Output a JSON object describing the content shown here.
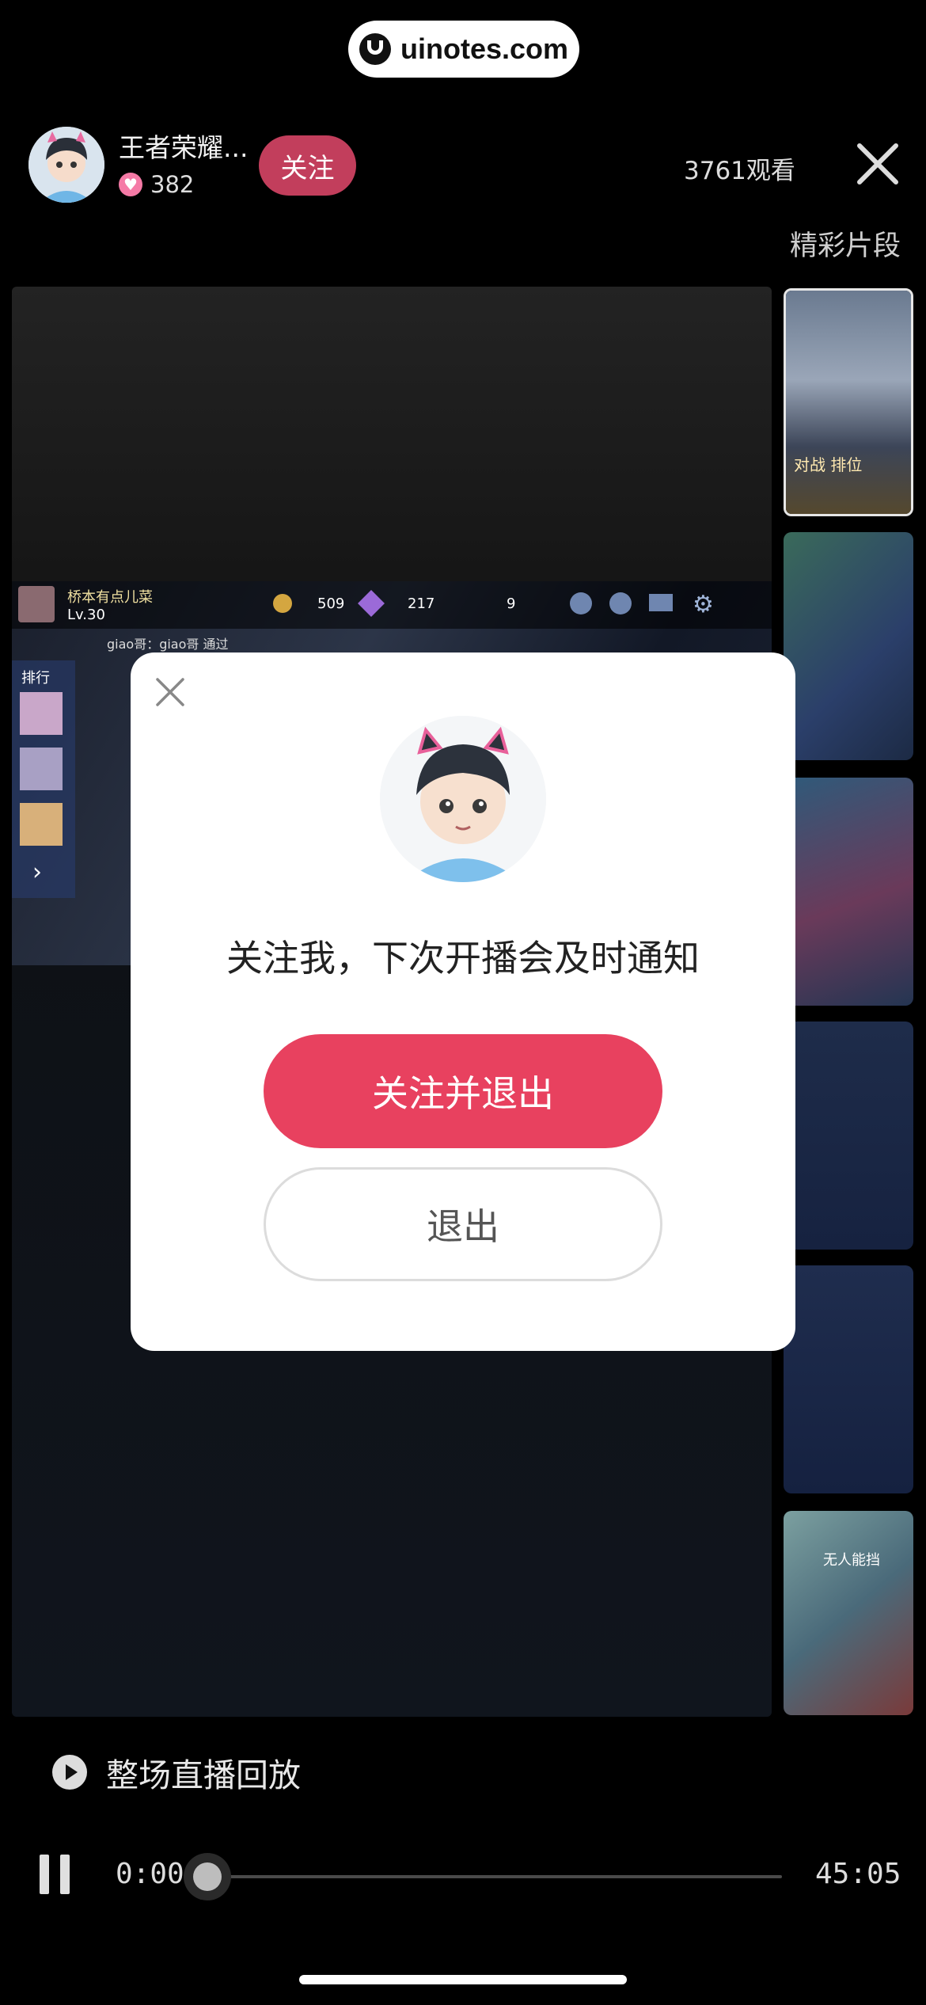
{
  "watermark": {
    "text": "uinotes.com"
  },
  "header": {
    "streamer_name": "王者荣耀...",
    "likes": "382",
    "follow_label": "关注",
    "views": "3761观看",
    "highlights_label": "精彩片段"
  },
  "game_overlay": {
    "player_name": "桥本有点儿菜",
    "level": "Lv.30",
    "coins": "509",
    "gems": "217",
    "tickets": "9",
    "chat": "giao哥：giao哥 通过",
    "rank_label": "排行"
  },
  "thumbnails": [
    {
      "label": "对战  排位",
      "selected": true,
      "color": "#5c6b82"
    },
    {
      "label": "",
      "selected": false,
      "color": "#3a5a4a"
    },
    {
      "label": "",
      "selected": false,
      "color": "#2f4b6a"
    },
    {
      "label": "",
      "selected": false,
      "color": "#1e2c4a"
    },
    {
      "label": "",
      "selected": false,
      "color": "#1f2d4e"
    },
    {
      "label": "无人能挡",
      "selected": false,
      "color": "#4d6a5a"
    }
  ],
  "dialog": {
    "message": "关注我，下次开播会及时通知",
    "primary_label": "关注并退出",
    "secondary_label": "退出"
  },
  "replay": {
    "label": "整场直播回放"
  },
  "player": {
    "current_time": "0:00",
    "duration": "45:05",
    "progress": 0
  },
  "colors": {
    "accent": "#e8415f",
    "follow": "#c23e5c"
  }
}
